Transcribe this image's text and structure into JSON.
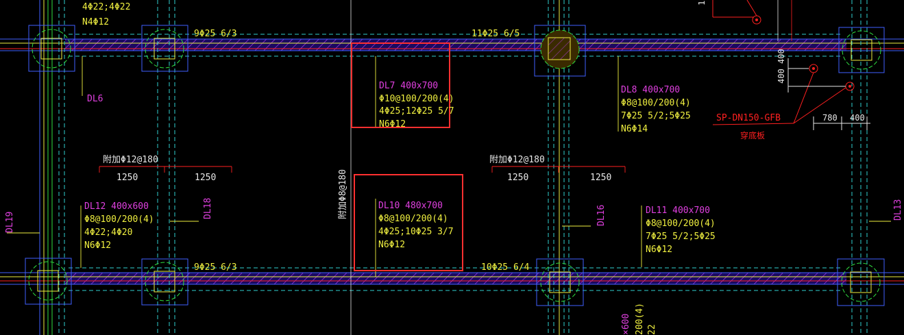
{
  "colors": {
    "background": "#000000",
    "magenta": "#e040e0",
    "yellow": "#f0f040",
    "green": "#30e040",
    "cyan": "#30d0d0",
    "blue": "#4060ff",
    "red": "#ff2020",
    "white": "#e8e8e8",
    "highlight_box": "#ff3030"
  },
  "top_clipped": {
    "line1": "4Φ22;4Φ22",
    "line2": "N4Φ12"
  },
  "beams": {
    "dl6": "DL6",
    "dl7": {
      "name": "DL7  400x700",
      "l1": "Φ10@100/200(4)",
      "l2": "4Φ25;12Φ25 5/7",
      "l3": "N6Φ12"
    },
    "dl8": {
      "name": "DL8  400x700",
      "l1": "Φ8@100/200(4)",
      "l2": "7Φ25 5/2;5Φ25",
      "l3": "N6Φ14"
    },
    "dl10": {
      "name": "DL10  480x700",
      "l1": "Φ8@100/200(4)",
      "l2": "4Φ25;10Φ25 3/7",
      "l3": "N6Φ12"
    },
    "dl11": {
      "name": "DL11  400x700",
      "l1": "Φ8@100/200(4)",
      "l2": "7Φ25 5/2;5Φ25",
      "l3": "N6Φ12"
    },
    "dl12": {
      "name": "DL12  400x600",
      "l1": "Φ8@100/200(4)",
      "l2": "4Φ22;4Φ20",
      "l3": "N6Φ12"
    },
    "dl13": "DL13",
    "dl16": "DL16",
    "dl18": "DL18",
    "dl19": "DL19"
  },
  "rebar_labels": {
    "top_left": "9Φ25 6/3",
    "top_mid": "11Φ25 6/5",
    "bottom_left": "9Φ25 6/3",
    "bottom_mid": "10Φ25 6/4"
  },
  "additional": {
    "left_title": "附加Φ12@180",
    "left_dim1": "1250",
    "left_dim2": "1250",
    "right_title": "附加Φ12@180",
    "right_dim1": "1250",
    "right_dim2": "1250",
    "vertical": "附加Φ8@180"
  },
  "pipe": {
    "label": "SP-DN150-GFB",
    "sublabel": "穿底板",
    "dim1": "780",
    "dim2": "400",
    "vdim": "400 400",
    "top_tick": "1"
  },
  "bottom_clipped": {
    "c1": "×600",
    "c2": "200(4)",
    "c3": "22"
  }
}
